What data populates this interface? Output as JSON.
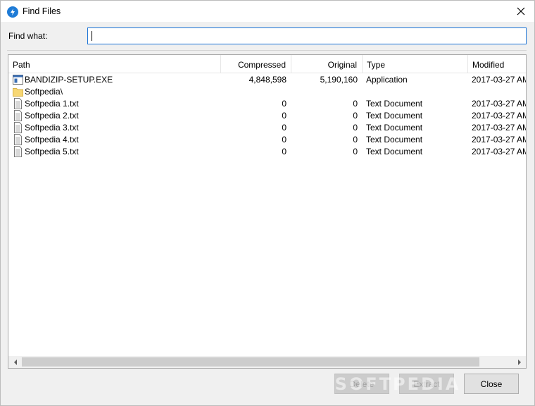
{
  "window": {
    "title": "Find Files"
  },
  "find": {
    "label": "Find what:",
    "value": ""
  },
  "columns": [
    {
      "label": "Path"
    },
    {
      "label": "Compressed"
    },
    {
      "label": "Original"
    },
    {
      "label": "Type"
    },
    {
      "label": "Modified"
    }
  ],
  "rows": [
    {
      "icon": "exe-file-icon",
      "path": "BANDIZIP-SETUP.EXE",
      "compressed": "4,848,598",
      "original": "5,190,160",
      "type": "Application",
      "modified": "2017-03-27 AM"
    },
    {
      "icon": "folder-icon",
      "path": "Softpedia\\",
      "compressed": "",
      "original": "",
      "type": "",
      "modified": ""
    },
    {
      "icon": "text-file-icon",
      "path": "Softpedia 1.txt",
      "compressed": "0",
      "original": "0",
      "type": "Text Document",
      "modified": "2017-03-27 AM"
    },
    {
      "icon": "text-file-icon",
      "path": "Softpedia 2.txt",
      "compressed": "0",
      "original": "0",
      "type": "Text Document",
      "modified": "2017-03-27 AM"
    },
    {
      "icon": "text-file-icon",
      "path": "Softpedia 3.txt",
      "compressed": "0",
      "original": "0",
      "type": "Text Document",
      "modified": "2017-03-27 AM"
    },
    {
      "icon": "text-file-icon",
      "path": "Softpedia 4.txt",
      "compressed": "0",
      "original": "0",
      "type": "Text Document",
      "modified": "2017-03-27 AM"
    },
    {
      "icon": "text-file-icon",
      "path": "Softpedia 5.txt",
      "compressed": "0",
      "original": "0",
      "type": "Text Document",
      "modified": "2017-03-27 AM"
    }
  ],
  "buttons": {
    "delete": "Delete",
    "extract": "Extract",
    "close": "Close"
  },
  "watermark": "SOFTPEDIA",
  "colors": {
    "accent": "#1a73d6",
    "app_icon": "#1e7bd6",
    "folder": "#f7d774",
    "disabled_button": "#cccccc"
  }
}
